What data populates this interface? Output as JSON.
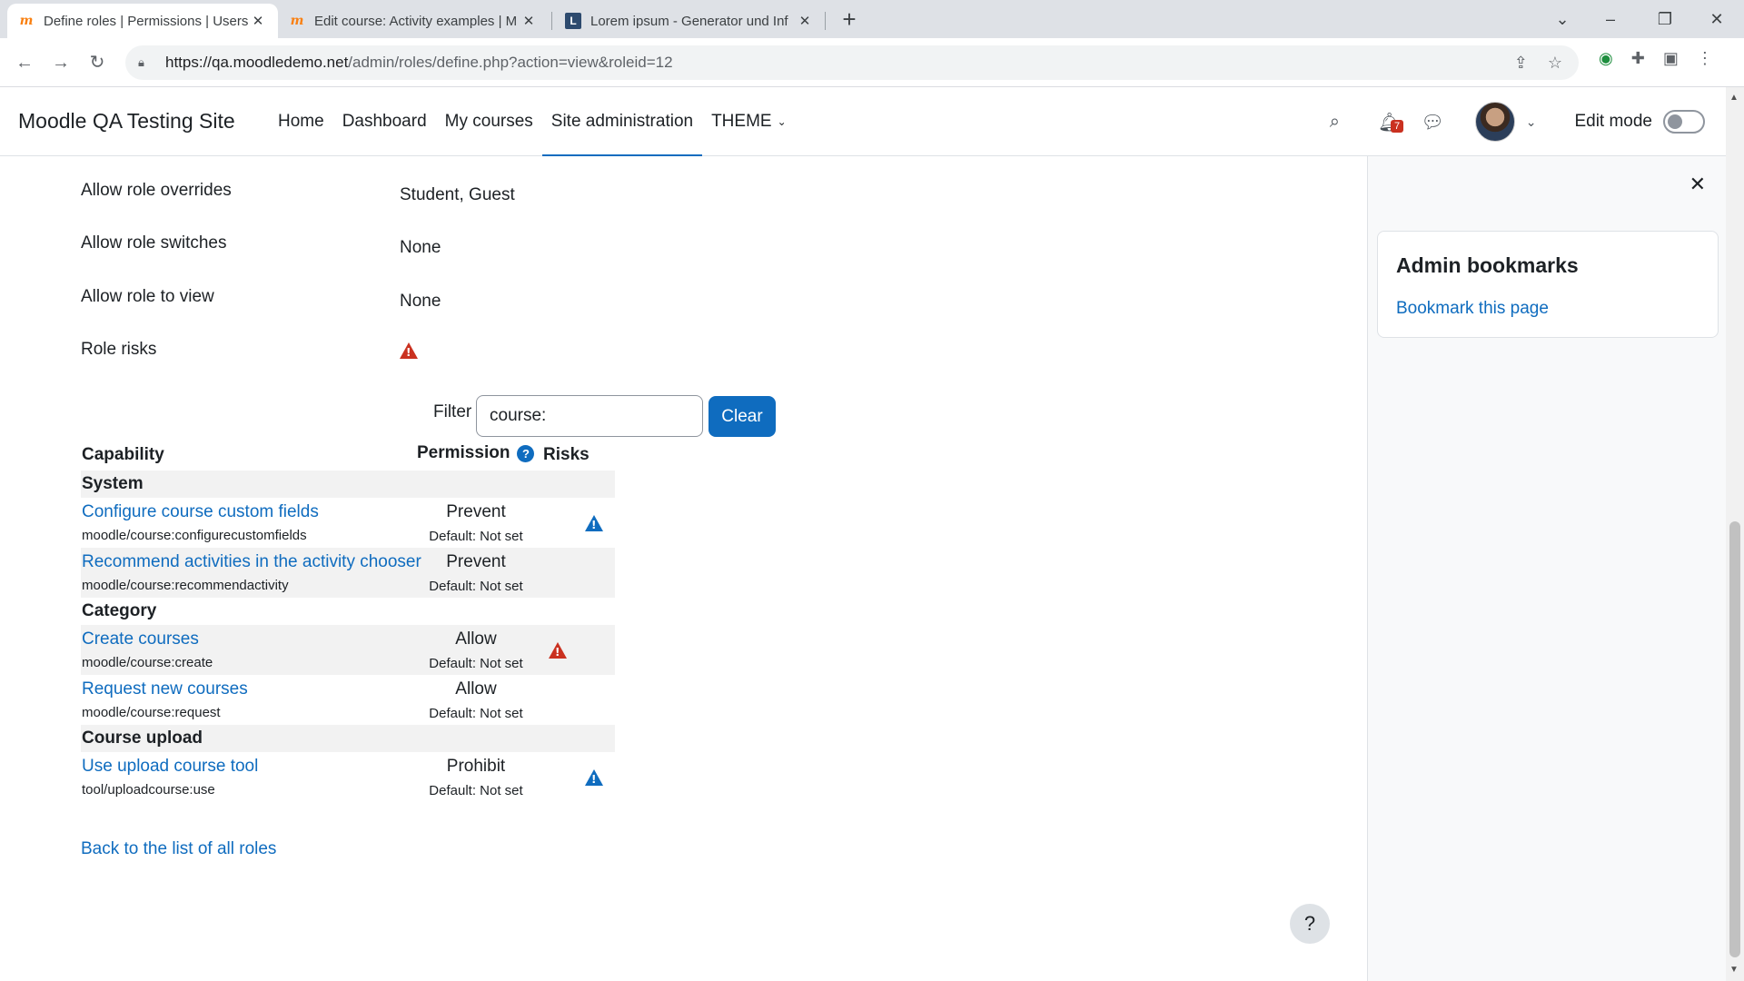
{
  "browser": {
    "tabs": [
      {
        "title": "Define roles | Permissions | Users",
        "favicon": "moodle-icon",
        "active": true
      },
      {
        "title": "Edit course: Activity examples | M",
        "favicon": "moodle-icon",
        "active": false
      },
      {
        "title": "Lorem ipsum - Generator und Inf",
        "favicon": "lorem-icon",
        "active": false
      }
    ],
    "url_host": "https://qa.moodledemo.net",
    "url_path": "/admin/roles/define.php?action=view&roleid=12"
  },
  "navbar": {
    "site_name": "Moodle QA Testing Site",
    "items": [
      {
        "label": "Home"
      },
      {
        "label": "Dashboard"
      },
      {
        "label": "My courses"
      },
      {
        "label": "Site administration",
        "active": true
      },
      {
        "label": "THEME"
      }
    ],
    "notification_count": "7",
    "edit_mode_label": "Edit mode"
  },
  "role": {
    "fields": [
      {
        "label": "Allow role overrides",
        "value": "Student, Guest"
      },
      {
        "label": "Allow role switches",
        "value": "None"
      },
      {
        "label": "Allow role to view",
        "value": "None"
      },
      {
        "label": "Role risks",
        "value": ""
      }
    ]
  },
  "filter": {
    "label": "Filter",
    "value": "course:",
    "clear_label": "Clear"
  },
  "table": {
    "headers": {
      "capability": "Capability",
      "permission": "Permission",
      "risks": "Risks"
    },
    "sections": [
      {
        "name": "System"
      },
      {
        "name": "Category"
      },
      {
        "name": "Course upload"
      }
    ],
    "rows": [
      {
        "name": "Configure course custom fields",
        "code": "moodle/course:configurecustomfields",
        "permission": "Prevent",
        "default": "Default: Not set",
        "risk": "blue"
      },
      {
        "name": "Recommend activities in the activity chooser",
        "code": "moodle/course:recommendactivity",
        "permission": "Prevent",
        "default": "Default: Not set",
        "risk": ""
      },
      {
        "name": "Create courses",
        "code": "moodle/course:create",
        "permission": "Allow",
        "default": "Default: Not set",
        "risk": "red"
      },
      {
        "name": "Request new courses",
        "code": "moodle/course:request",
        "permission": "Allow",
        "default": "Default: Not set",
        "risk": ""
      },
      {
        "name": "Use upload course tool",
        "code": "tool/uploadcourse:use",
        "permission": "Prohibit",
        "default": "Default: Not set",
        "risk": "blue"
      }
    ]
  },
  "back_link": "Back to the list of all roles",
  "help_button": "?",
  "drawer": {
    "block_title": "Admin bookmarks",
    "bookmark_link": "Bookmark this page"
  },
  "colors": {
    "accent": "#0f6cbf",
    "risk_red": "#ca3120",
    "risk_blue": "#0f6cbf"
  }
}
